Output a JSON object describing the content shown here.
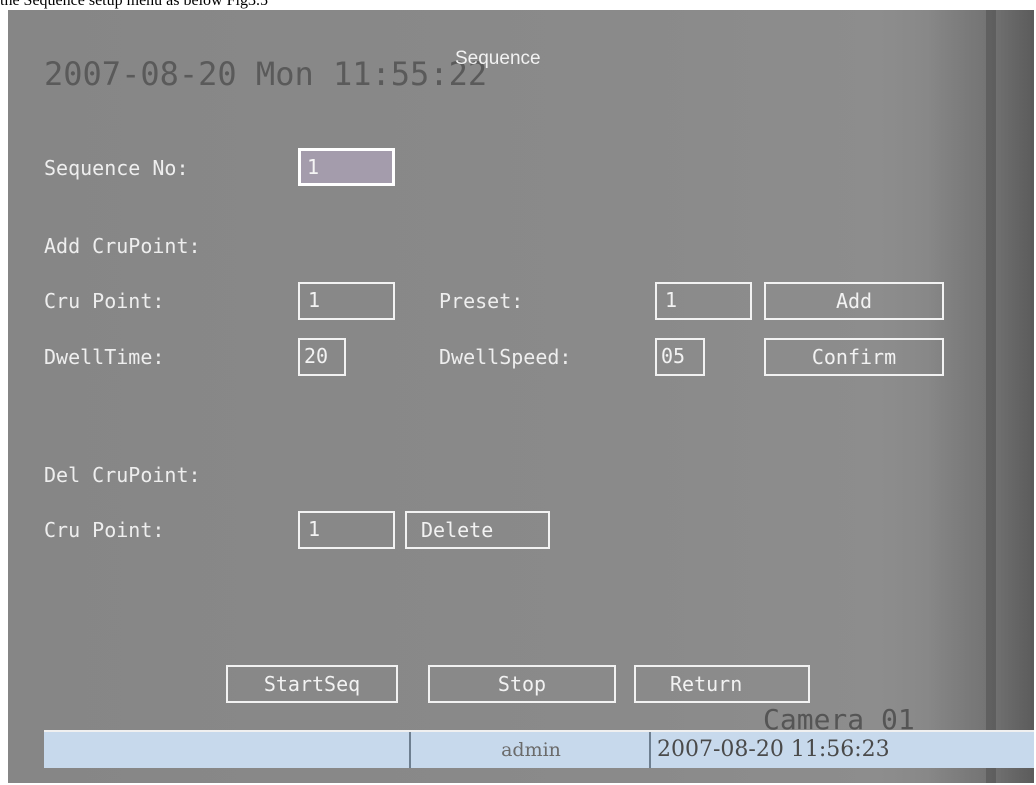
{
  "caption": "the Sequence setup menu as below Fig3.5",
  "osd": {
    "datetime": "2007-08-20 Mon 11:55:22",
    "title": "Sequence",
    "camera": "Camera 01"
  },
  "form": {
    "sequence_no_label": "Sequence No:",
    "sequence_no_value": "1",
    "add_section_label": "Add CruPoint:",
    "add_cru_point_label": "Cru Point:",
    "add_cru_point_value": "1",
    "preset_label": "Preset:",
    "preset_value": "1",
    "add_button": "Add",
    "dwell_time_label": "DwellTime:",
    "dwell_time_value": "20",
    "dwell_speed_label": "DwellSpeed:",
    "dwell_speed_value": "05",
    "confirm_button": "Confirm",
    "del_section_label": "Del CruPoint:",
    "del_cru_point_label": "Cru Point:",
    "del_cru_point_value": "1",
    "delete_button": "Delete"
  },
  "actions": {
    "start": "StartSeq",
    "stop": "Stop",
    "return": "Return"
  },
  "statusbar": {
    "user": "admin",
    "time": "2007-08-20 11:56:23"
  }
}
